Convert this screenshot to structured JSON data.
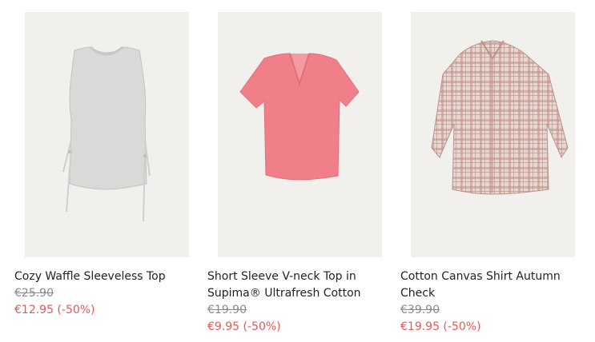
{
  "products": [
    {
      "name": "Cozy Waffle Sleeveless Top",
      "old_price": "€25.90",
      "sale_price": "€12.95 (-50%)",
      "image": "grey-sleeveless-top",
      "color": "#d9d9d7"
    },
    {
      "name": "Short Sleeve V-neck Top in Supima® Ultrafresh Cotton",
      "old_price": "€19.90",
      "sale_price": "€9.95 (-50%)",
      "image": "pink-vneck-top",
      "color": "#f07f8a"
    },
    {
      "name": "Cotton Canvas Shirt Autumn Check",
      "old_price": "€39.90",
      "sale_price": "€19.95 (-50%)",
      "image": "checked-shirt",
      "color": "#c9a59b"
    }
  ],
  "colors": {
    "sale": "#e05a5a",
    "old_price": "#8a8a8a",
    "tile_background": "#f2f0ec"
  }
}
